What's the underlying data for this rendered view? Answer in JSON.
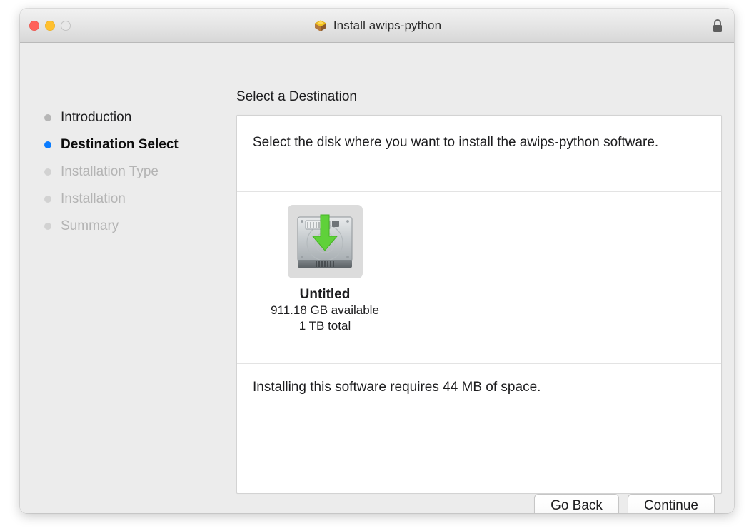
{
  "window": {
    "title": "Install awips-python",
    "title_icon": "package-icon",
    "lock_icon": "lock-closed-icon",
    "traffic_lights": [
      {
        "name": "close",
        "color": "#ff6159"
      },
      {
        "name": "minimize",
        "color": "#ffc02e"
      },
      {
        "name": "zoom",
        "color": "#e8e8e8"
      }
    ]
  },
  "sidebar": {
    "items": [
      {
        "label": "Introduction",
        "state": "done"
      },
      {
        "label": "Destination Select",
        "state": "active"
      },
      {
        "label": "Installation Type",
        "state": "upcoming"
      },
      {
        "label": "Installation",
        "state": "upcoming"
      },
      {
        "label": "Summary",
        "state": "upcoming"
      }
    ]
  },
  "main": {
    "pane_title": "Select a Destination",
    "intro_text": "Select the disk where you want to install the awips-python software.",
    "disks": [
      {
        "name": "Untitled",
        "available": "911.18 GB available",
        "total": "1 TB total",
        "icon": "hard-drive-download-icon",
        "selected": true
      }
    ],
    "space_note": "Installing this software requires 44 MB of space."
  },
  "footer": {
    "go_back_label": "Go Back",
    "continue_label": "Continue"
  },
  "colors": {
    "accent": "#0a7cff",
    "window_bg": "#ececec",
    "panel_bg": "#ffffff",
    "selection_bg": "#dcdcdc",
    "arrow_green": "#5fd13a"
  }
}
